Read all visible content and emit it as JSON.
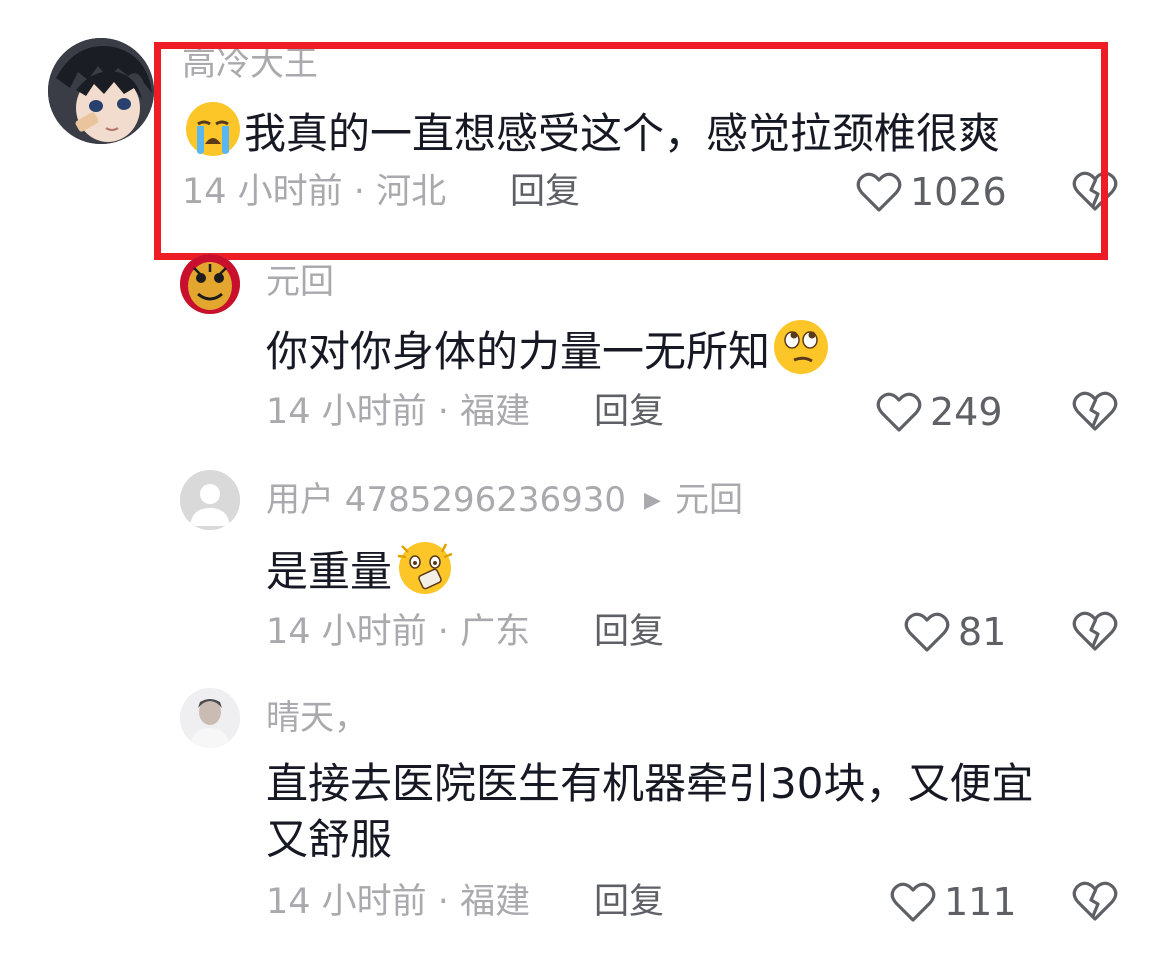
{
  "comments": [
    {
      "username": "高冷大王",
      "text": "我真的一直想感受这个，感觉拉颈椎很爽",
      "emoji": "loudly-crying-face",
      "time": "14 小时前",
      "location": "河北",
      "reply_label": "回复",
      "likes": "1026"
    },
    {
      "username": "元回",
      "text": "你对你身体的力量一无所知",
      "emoji": "eye-roll-face",
      "time": "14 小时前",
      "location": "福建",
      "reply_label": "回复",
      "likes": "249"
    },
    {
      "username": "用户 4785296236930",
      "reply_to": "元回",
      "text": "是重量",
      "emoji": "shocked-face",
      "time": "14 小时前",
      "location": "广东",
      "reply_label": "回复",
      "likes": "81"
    },
    {
      "username": "晴天，",
      "text_line1": "直接去医院医生有机器牵引30块，又便宜",
      "text_line2": "又舒服",
      "time": "14 小时前",
      "location": "福建",
      "reply_label": "回复",
      "likes": "111"
    }
  ],
  "separator": " · ",
  "colors": {
    "highlight_border": "#ee1c25",
    "meta_text": "#a9a9ae",
    "main_text": "#161823"
  }
}
